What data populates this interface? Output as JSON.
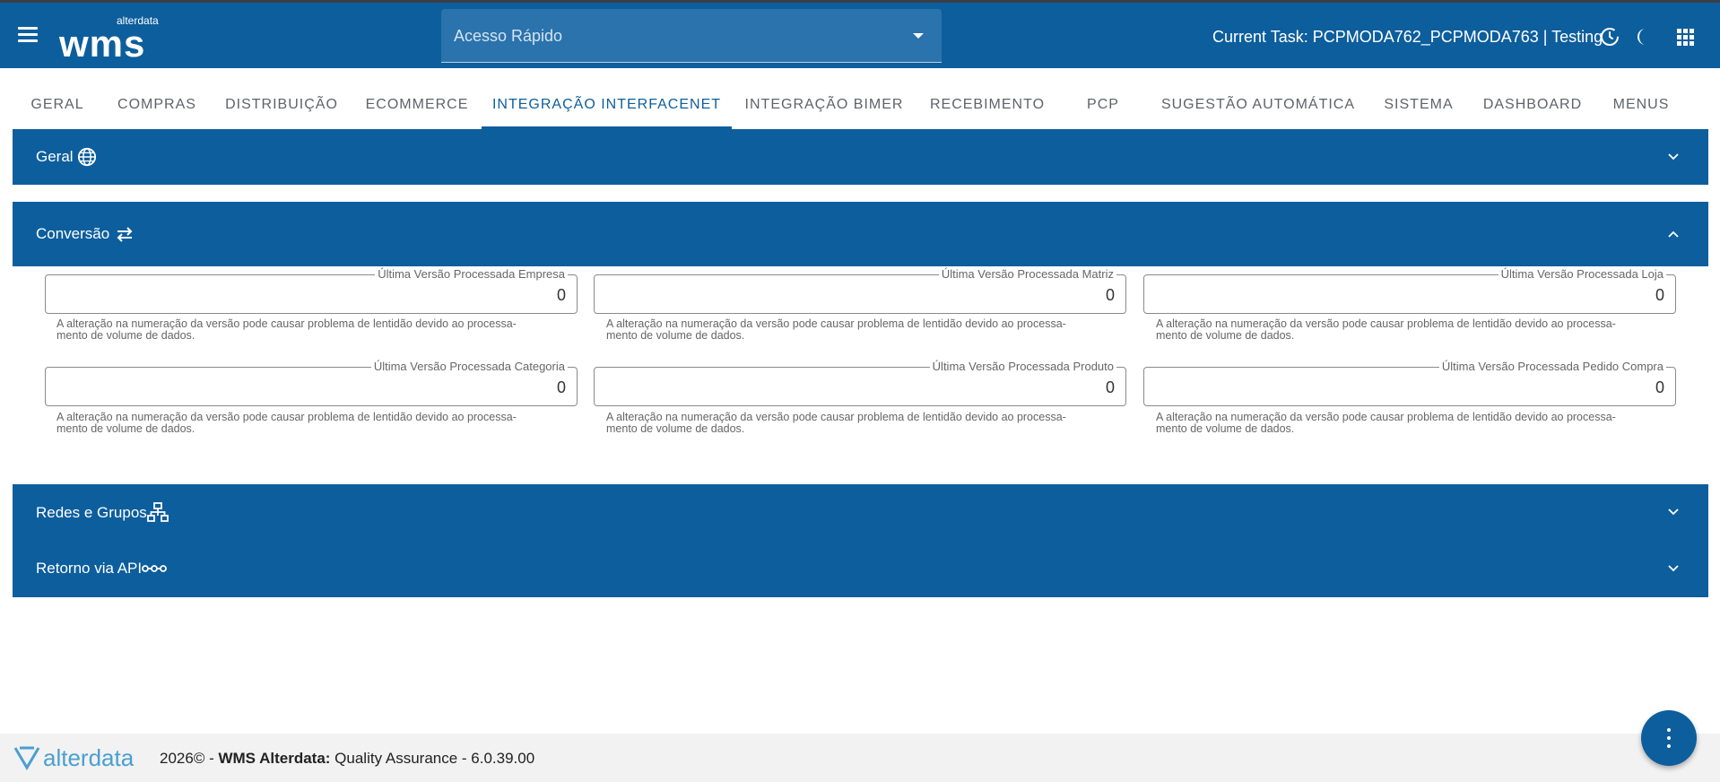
{
  "header": {
    "logo_small": "alterdata",
    "logo_big": "wms",
    "quick_access_placeholder": "Acesso Rápido",
    "current_task": "Current Task: PCPMODA762_PCPMODA763 | Testing"
  },
  "tabs": [
    {
      "label": "GERAL"
    },
    {
      "label": "COMPRAS"
    },
    {
      "label": "DISTRIBUIÇÃO"
    },
    {
      "label": "ECOMMERCE"
    },
    {
      "label": "INTEGRAÇÃO INTERFACENET",
      "active": true
    },
    {
      "label": "INTEGRAÇÃO BIMER"
    },
    {
      "label": "RECEBIMENTO"
    },
    {
      "label": "PCP"
    },
    {
      "label": "SUGESTÃO AUTOMÁTICA"
    },
    {
      "label": "SISTEMA"
    },
    {
      "label": "DASHBOARD"
    },
    {
      "label": "MENUS"
    }
  ],
  "panels": {
    "geral": {
      "title": "Geral",
      "icon": "globe-icon",
      "expanded": false
    },
    "conversao": {
      "title": "Conversão",
      "icon": "swap-icon",
      "expanded": true
    },
    "redes": {
      "title": "Redes e Grupos",
      "icon": "network-icon",
      "expanded": false
    },
    "retorno": {
      "title": "Retorno via API",
      "icon": "api-icon",
      "expanded": false
    }
  },
  "fields": [
    {
      "label": "Última Versão Processada Empresa",
      "value": "0"
    },
    {
      "label": "Última Versão Processada Matriz",
      "value": "0"
    },
    {
      "label": "Última Versão Processada Loja",
      "value": "0"
    },
    {
      "label": "Última Versão Processada Categoria",
      "value": "0"
    },
    {
      "label": "Última Versão Processada Produto",
      "value": "0"
    },
    {
      "label": "Última Versão Processada Pedido Compra",
      "value": "0"
    }
  ],
  "hint": {
    "line1": "A alteração na numeração da versão pode causar problema de lentidão devido ao processa-",
    "line2": "mento de volume de dados."
  },
  "footer": {
    "brand": "alterdata",
    "year": "2026© - ",
    "product": "WMS Alterdata:",
    "environment": " Quality Assurance - 6.0.39.00"
  },
  "colors": {
    "primary": "#0d5e9d",
    "appbar_dark_line": "#3a3f45",
    "footer_bg": "#f2f2f2"
  }
}
